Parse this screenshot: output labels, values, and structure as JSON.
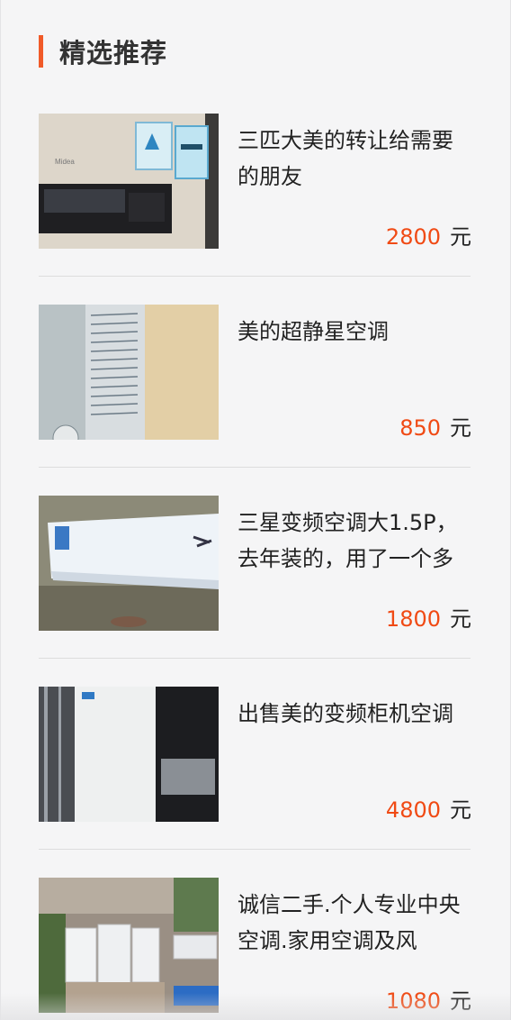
{
  "section": {
    "title": "精选推荐"
  },
  "items": [
    {
      "name": "三匹大美的转让给需要的朋友",
      "price": "2800",
      "unit": "元",
      "image_icon": "air-conditioner-panel-photo"
    },
    {
      "name": "美的超静星空调",
      "price": "850",
      "unit": "元",
      "image_icon": "spec-label-photo"
    },
    {
      "name": "三星变频空调大1.5P，去年装的，用了一个多",
      "price": "1800",
      "unit": "元",
      "image_icon": "wall-unit-photo"
    },
    {
      "name": "出售美的变频柜机空调",
      "price": "4800",
      "unit": "元",
      "image_icon": "cabinet-unit-photo"
    },
    {
      "name": "诚信二手.个人专业中央空调.家用空调及风",
      "price": "1080",
      "unit": "元",
      "image_icon": "outdoor-units-photo"
    }
  ],
  "colors": {
    "accent": "#f05a28",
    "price": "#f04a14",
    "text": "#222222",
    "background": "#f5f5f6"
  }
}
